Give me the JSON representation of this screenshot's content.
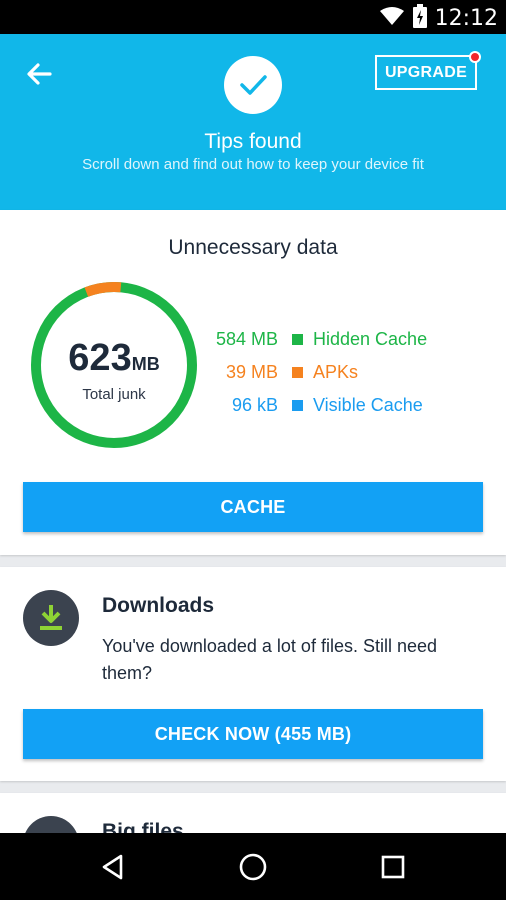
{
  "status_bar": {
    "time": "12:12",
    "icons": [
      "wifi-icon",
      "battery-charging-icon"
    ]
  },
  "header": {
    "title": "Tips found",
    "subtitle": "Scroll down and find out how to keep your device fit",
    "upgrade_label": "UPGRADE",
    "background": "#11b7e9"
  },
  "unnecessary_data": {
    "title": "Unnecessary data",
    "total_value": "623",
    "total_unit": "MB",
    "total_label": "Total junk",
    "items": [
      {
        "value": "584 MB",
        "label": "Hidden Cache",
        "color": "#1db547"
      },
      {
        "value": "39 MB",
        "label": "APKs",
        "color": "#f5821f"
      },
      {
        "value": "96 kB",
        "label": "Visible Cache",
        "color": "#1a9cf0"
      }
    ],
    "button_label": "CACHE"
  },
  "downloads": {
    "title": "Downloads",
    "text": "You've downloaded a lot of files. Still need them?",
    "button_label": "CHECK NOW (455 MB)"
  },
  "big_files": {
    "title": "Big files"
  },
  "colors": {
    "accent_button": "#12a1f5",
    "notification_dot": "#f2262b"
  }
}
